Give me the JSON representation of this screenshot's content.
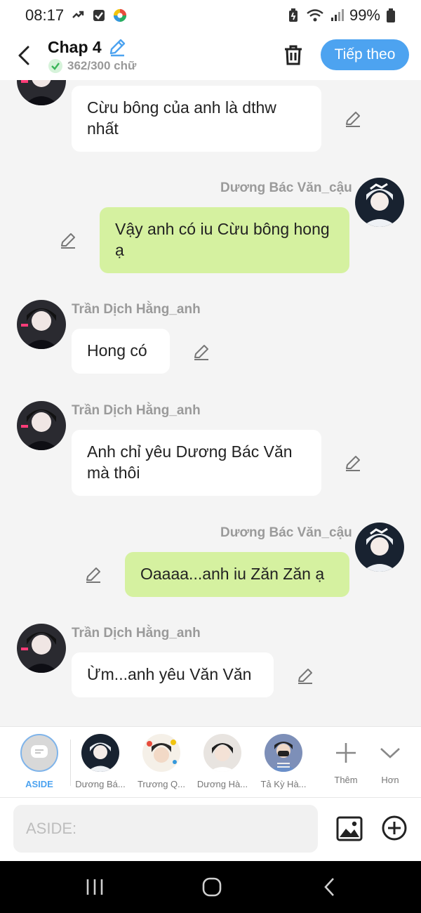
{
  "status_bar": {
    "time": "08:17",
    "battery": "99%"
  },
  "header": {
    "title": "Chap 4",
    "word_count": "362/300 chữ",
    "next_label": "Tiếp theo"
  },
  "messages": [
    {
      "side": "left",
      "sender": "",
      "text": "Cừu bông của anh là dthw nhất"
    },
    {
      "side": "right",
      "sender": "Dương Bác Văn_cậu",
      "text": "Vậy anh có iu Cừu bông hong ạ"
    },
    {
      "side": "left",
      "sender": "Trần Dịch Hằng_anh",
      "text": "Hong có"
    },
    {
      "side": "left",
      "sender": "Trần Dịch Hằng_anh",
      "text": "Anh chỉ yêu Dương Bác Văn mà thôi"
    },
    {
      "side": "right",
      "sender": "Dương Bác Văn_cậu",
      "text": "Oaaaa...anh iu Zăn Zăn ạ"
    },
    {
      "side": "left",
      "sender": "Trần Dịch Hằng_anh",
      "text": "Ừm...anh yêu Văn Văn"
    }
  ],
  "characters": {
    "aside_label": "ASIDE",
    "items": [
      {
        "label": "Dương Bá..."
      },
      {
        "label": "Trương Q..."
      },
      {
        "label": "Dương Hà..."
      },
      {
        "label": "Tả Kỳ Hà..."
      }
    ],
    "add_label": "Thêm",
    "more_label": "Hơn"
  },
  "input": {
    "placeholder": "ASIDE:"
  },
  "colors": {
    "accent": "#4da3f0",
    "right_bubble": "#d5f1a0",
    "left_bubble": "#ffffff",
    "background": "#f4f4f4"
  },
  "icons": {
    "header": [
      "back-arrow-icon",
      "pencil-icon",
      "check-circle-icon",
      "trash-icon"
    ],
    "input": [
      "image-icon",
      "plus-circle-icon"
    ],
    "nav": [
      "recents-icon",
      "home-icon",
      "back-icon"
    ]
  }
}
